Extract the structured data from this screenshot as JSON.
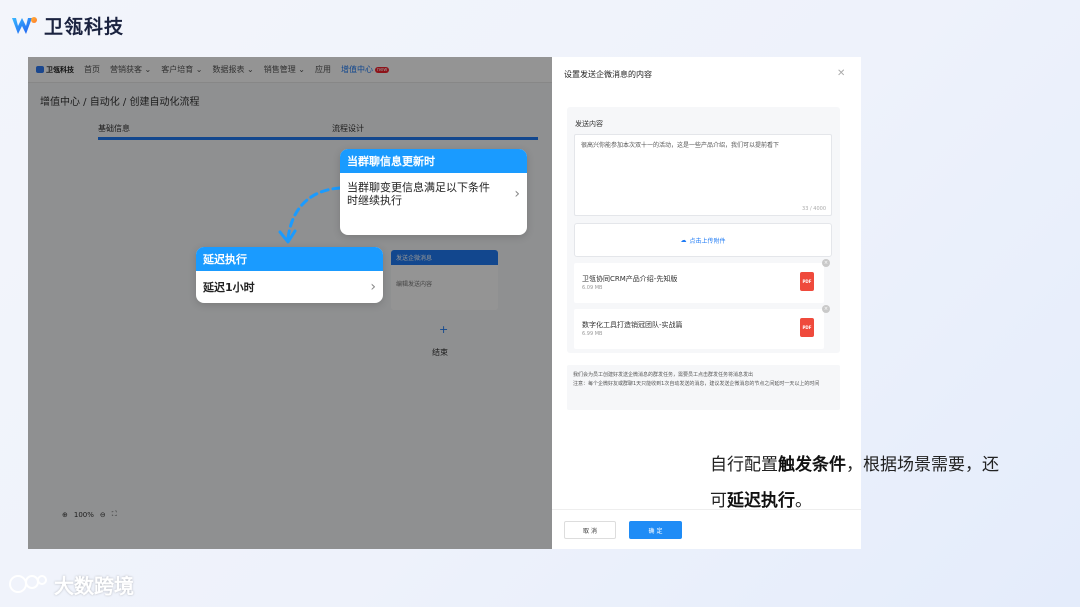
{
  "brand": {
    "name": "卫瓴科技",
    "logo_icon": "brand-w-logo"
  },
  "app": {
    "mini_logo": "卫瓴科技",
    "nav": [
      {
        "label": "首页"
      },
      {
        "label": "营销获客 ⌄"
      },
      {
        "label": "客户培育 ⌄"
      },
      {
        "label": "数据报表 ⌄"
      },
      {
        "label": "销售管理 ⌄"
      },
      {
        "label": "应用"
      },
      {
        "label": "增值中心",
        "badge": "new"
      }
    ],
    "breadcrumb": "增值中心 / 自动化 / 创建自动化流程",
    "steps": [
      "基础信息",
      "流程设计"
    ],
    "flow_node": {
      "title": "发送企微消息",
      "body": "编辑发送内容"
    },
    "flow_plus": "+",
    "flow_end": "结束",
    "zoom": {
      "level": "100%"
    }
  },
  "callouts": {
    "trigger": {
      "title": "当群聊信息更新时",
      "body": "当群聊变更信息满足以下条件时继续执行"
    },
    "delay": {
      "title": "延迟执行",
      "body": "延迟1小时"
    }
  },
  "drawer": {
    "title": "设置发送企微消息的内容",
    "content_label": "发送内容",
    "message": "很高兴你能参加本次双十一的活动，这是一些产品介绍，我们可以提前看下",
    "counter": "33 / 4000",
    "upload_label": "点击上传附件",
    "files": [
      {
        "name": "卫瓴协同CRM产品介绍-先知版",
        "size": "6.09 MB",
        "type": "PDF"
      },
      {
        "name": "数字化工具打造销冠团队-实战篇",
        "size": "6.99 MB",
        "type": "PDF"
      }
    ],
    "notice_1": "我们会为员工创建好发送企微消息的群发任务，需要员工点击群发任务将消息发出",
    "notice_2": "注意：每个企微好友或群聊1天只能收到1次自动发送的消息，建议发送企微消息的节点之间延时一天以上的时间",
    "cancel": "取 消",
    "confirm": "确 定"
  },
  "caption": {
    "part1": "自行配置",
    "bold1": "触发条件",
    "part2": "，根据场景需要，还",
    "part3": "可",
    "bold2": "延迟执行",
    "part4": "。"
  },
  "watermark": "大数跨境",
  "colors": {
    "accent": "#1a9bff",
    "primary": "#1f7bf5",
    "pdf": "#ef4a3c"
  }
}
